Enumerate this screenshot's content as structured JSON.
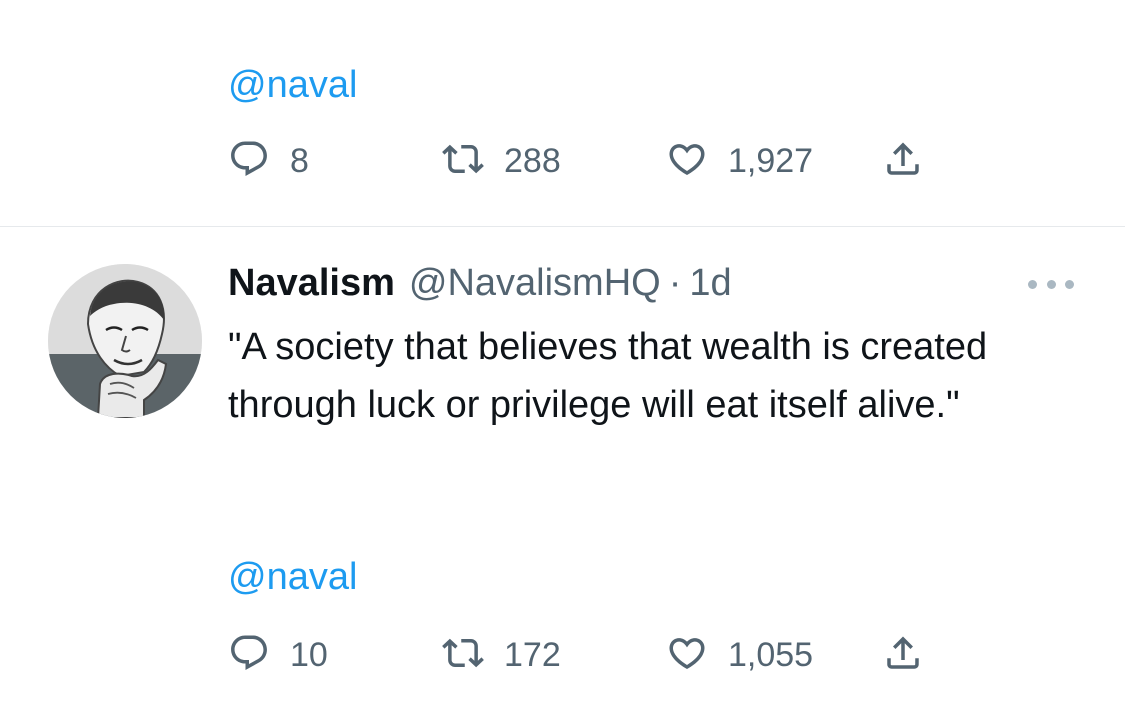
{
  "tweet1": {
    "mention": "@naval",
    "replies": "8",
    "retweets": "288",
    "likes": "1,927"
  },
  "tweet2": {
    "author_name": "Navalism",
    "author_handle": "@NavalismHQ",
    "separator": "·",
    "time": "1d",
    "text": "\"A society that believes that wealth is created through luck or privilege will eat itself alive.\"",
    "mention": "@naval",
    "replies": "10",
    "retweets": "172",
    "likes": "1,055"
  },
  "icons": {
    "reply": "reply-icon",
    "retweet": "retweet-icon",
    "like": "heart-icon",
    "share": "share-icon",
    "more": "more-icon"
  },
  "colors": {
    "link": "#1d9bf0",
    "secondary_text": "#536471",
    "primary_text": "#0f1419",
    "divider": "#e6e9ec"
  }
}
